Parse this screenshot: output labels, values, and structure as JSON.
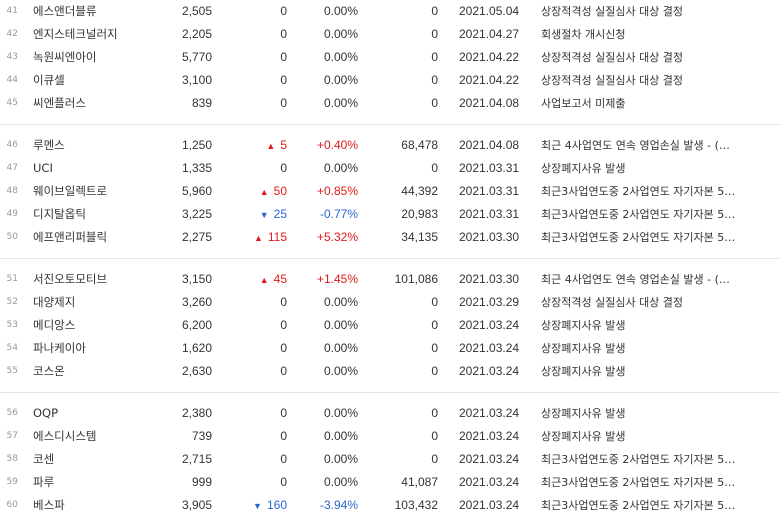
{
  "colors": {
    "up": "#e01a1a",
    "down": "#2866d6",
    "neutral": "#333333",
    "rowNumber": "#999999"
  },
  "icons": {
    "up": "▲",
    "down": "▼"
  },
  "groups": [
    {
      "rows": [
        {
          "no": "41",
          "name": "에스앤더블류",
          "price": "2,505",
          "dir": "neutral",
          "change": "0",
          "rate": "0.00%",
          "volume": "0",
          "date": "2021.05.04",
          "reason": "상장적격성 실질심사 대상 결정"
        },
        {
          "no": "42",
          "name": "엔지스테크널러지",
          "price": "2,205",
          "dir": "neutral",
          "change": "0",
          "rate": "0.00%",
          "volume": "0",
          "date": "2021.04.27",
          "reason": "회생절차 개시신청"
        },
        {
          "no": "43",
          "name": "녹원씨엔아이",
          "price": "5,770",
          "dir": "neutral",
          "change": "0",
          "rate": "0.00%",
          "volume": "0",
          "date": "2021.04.22",
          "reason": "상장적격성 실질심사 대상 결정"
        },
        {
          "no": "44",
          "name": "이큐셀",
          "price": "3,100",
          "dir": "neutral",
          "change": "0",
          "rate": "0.00%",
          "volume": "0",
          "date": "2021.04.22",
          "reason": "상장적격성 실질심사 대상 결정"
        },
        {
          "no": "45",
          "name": "씨엔플러스",
          "price": "839",
          "dir": "neutral",
          "change": "0",
          "rate": "0.00%",
          "volume": "0",
          "date": "2021.04.08",
          "reason": "사업보고서 미제출"
        }
      ]
    },
    {
      "rows": [
        {
          "no": "46",
          "name": "루멘스",
          "price": "1,250",
          "dir": "up",
          "change": "5",
          "rate": "+0.40%",
          "volume": "68,478",
          "date": "2021.04.08",
          "reason": "최근 4사업연도 연속 영업손실 발생 - (…"
        },
        {
          "no": "47",
          "name": "UCI",
          "price": "1,335",
          "dir": "neutral",
          "change": "0",
          "rate": "0.00%",
          "volume": "0",
          "date": "2021.03.31",
          "reason": "상장폐지사유 발생"
        },
        {
          "no": "48",
          "name": "웨이브일렉트로",
          "price": "5,960",
          "dir": "up",
          "change": "50",
          "rate": "+0.85%",
          "volume": "44,392",
          "date": "2021.03.31",
          "reason": "최근3사업연도중 2사업연도 자기자본 5…"
        },
        {
          "no": "49",
          "name": "디지탈옵틱",
          "price": "3,225",
          "dir": "down",
          "change": "25",
          "rate": "-0.77%",
          "volume": "20,983",
          "date": "2021.03.31",
          "reason": "최근3사업연도중 2사업연도 자기자본 5…"
        },
        {
          "no": "50",
          "name": "에프앤리퍼블릭",
          "price": "2,275",
          "dir": "up",
          "change": "115",
          "rate": "+5.32%",
          "volume": "34,135",
          "date": "2021.03.30",
          "reason": "최근3사업연도중 2사업연도 자기자본 5…"
        }
      ]
    },
    {
      "rows": [
        {
          "no": "51",
          "name": "서진오토모티브",
          "price": "3,150",
          "dir": "up",
          "change": "45",
          "rate": "+1.45%",
          "volume": "101,086",
          "date": "2021.03.30",
          "reason": "최근 4사업연도 연속 영업손실 발생 - (…"
        },
        {
          "no": "52",
          "name": "대양제지",
          "price": "3,260",
          "dir": "neutral",
          "change": "0",
          "rate": "0.00%",
          "volume": "0",
          "date": "2021.03.29",
          "reason": "상장적격성 실질심사 대상 결정"
        },
        {
          "no": "53",
          "name": "메디앙스",
          "price": "6,200",
          "dir": "neutral",
          "change": "0",
          "rate": "0.00%",
          "volume": "0",
          "date": "2021.03.24",
          "reason": "상장폐지사유 발생"
        },
        {
          "no": "54",
          "name": "파나케이아",
          "price": "1,620",
          "dir": "neutral",
          "change": "0",
          "rate": "0.00%",
          "volume": "0",
          "date": "2021.03.24",
          "reason": "상장폐지사유 발생"
        },
        {
          "no": "55",
          "name": "코스온",
          "price": "2,630",
          "dir": "neutral",
          "change": "0",
          "rate": "0.00%",
          "volume": "0",
          "date": "2021.03.24",
          "reason": "상장폐지사유 발생"
        }
      ]
    },
    {
      "rows": [
        {
          "no": "56",
          "name": "OQP",
          "price": "2,380",
          "dir": "neutral",
          "change": "0",
          "rate": "0.00%",
          "volume": "0",
          "date": "2021.03.24",
          "reason": "상장폐지사유 발생"
        },
        {
          "no": "57",
          "name": "에스디시스템",
          "price": "739",
          "dir": "neutral",
          "change": "0",
          "rate": "0.00%",
          "volume": "0",
          "date": "2021.03.24",
          "reason": "상장폐지사유 발생"
        },
        {
          "no": "58",
          "name": "코센",
          "price": "2,715",
          "dir": "neutral",
          "change": "0",
          "rate": "0.00%",
          "volume": "0",
          "date": "2021.03.24",
          "reason": "최근3사업연도중 2사업연도 자기자본 5…"
        },
        {
          "no": "59",
          "name": "파루",
          "price": "999",
          "dir": "neutral",
          "change": "0",
          "rate": "0.00%",
          "volume": "41,087",
          "date": "2021.03.24",
          "reason": "최근3사업연도중 2사업연도 자기자본 5…"
        },
        {
          "no": "60",
          "name": "베스파",
          "price": "3,905",
          "dir": "down",
          "change": "160",
          "rate": "-3.94%",
          "volume": "103,432",
          "date": "2021.03.24",
          "reason": "최근3사업연도중 2사업연도 자기자본 5…"
        }
      ]
    }
  ]
}
